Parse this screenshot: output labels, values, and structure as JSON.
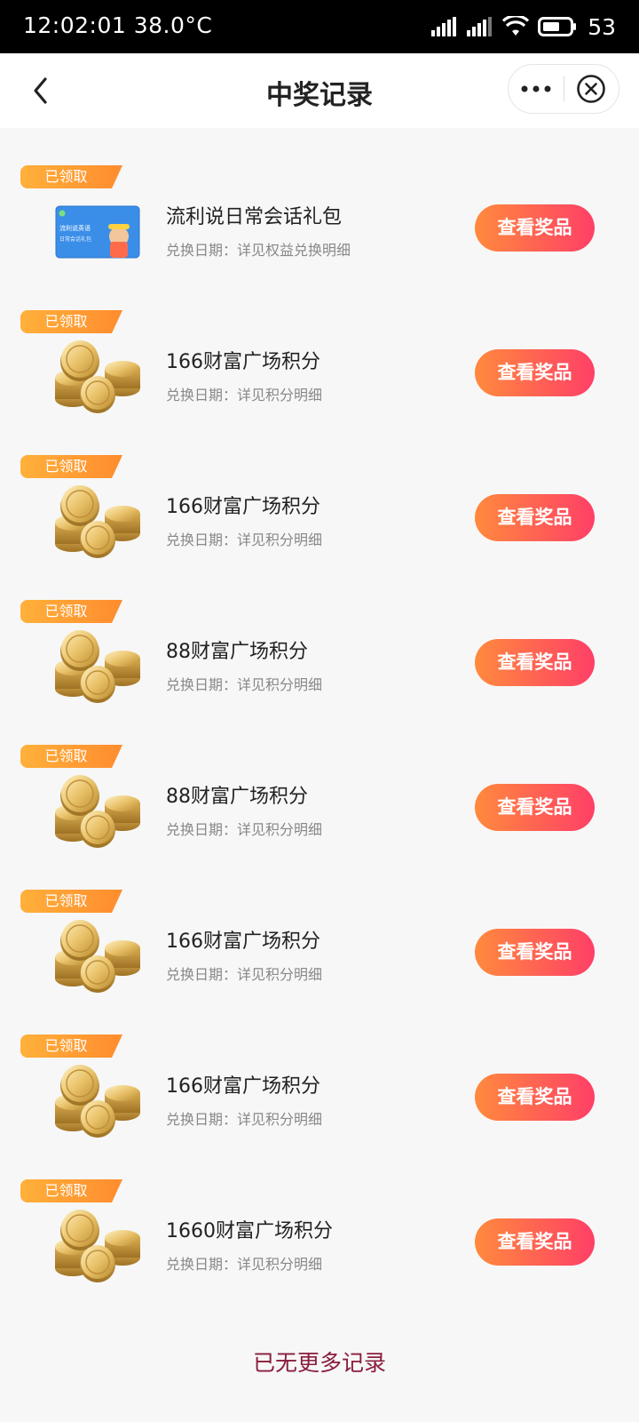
{
  "status_bar": {
    "time": "12:02:01 38.0°C",
    "battery_level": "53"
  },
  "nav": {
    "title": "中奖记录"
  },
  "records": [
    {
      "badge": "已领取",
      "title": "流利说日常会话礼包",
      "subtitle": "兑换日期：详见权益兑换明细",
      "button": "查看奖品",
      "thumb": "liulishuo-card",
      "card_brand": "流利说英语",
      "card_name": "日常会话礼包"
    },
    {
      "badge": "已领取",
      "title": "166财富广场积分",
      "subtitle": "兑换日期：详见积分明细",
      "button": "查看奖品",
      "thumb": "gold-coins"
    },
    {
      "badge": "已领取",
      "title": "166财富广场积分",
      "subtitle": "兑换日期：详见积分明细",
      "button": "查看奖品",
      "thumb": "gold-coins"
    },
    {
      "badge": "已领取",
      "title": "88财富广场积分",
      "subtitle": "兑换日期：详见积分明细",
      "button": "查看奖品",
      "thumb": "gold-coins"
    },
    {
      "badge": "已领取",
      "title": "88财富广场积分",
      "subtitle": "兑换日期：详见积分明细",
      "button": "查看奖品",
      "thumb": "gold-coins"
    },
    {
      "badge": "已领取",
      "title": "166财富广场积分",
      "subtitle": "兑换日期：详见积分明细",
      "button": "查看奖品",
      "thumb": "gold-coins"
    },
    {
      "badge": "已领取",
      "title": "166财富广场积分",
      "subtitle": "兑换日期：详见积分明细",
      "button": "查看奖品",
      "thumb": "gold-coins"
    },
    {
      "badge": "已领取",
      "title": "1660财富广场积分",
      "subtitle": "兑换日期：详见积分明细",
      "button": "查看奖品",
      "thumb": "gold-coins"
    }
  ],
  "footer": {
    "no_more": "已无更多记录"
  },
  "colors": {
    "badge": "#ff9a2e",
    "button_start": "#ff8a3d",
    "button_end": "#ff3f67",
    "footer_text": "#8a1d3d"
  }
}
